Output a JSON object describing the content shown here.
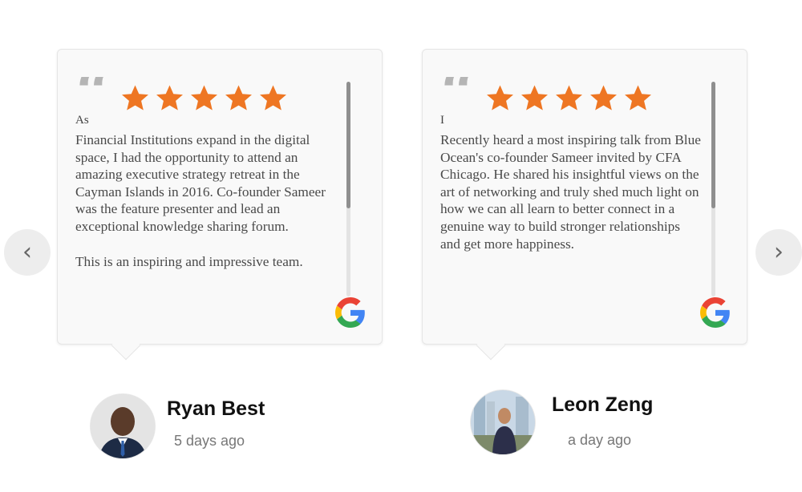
{
  "navigation": {
    "prev_icon": "‹",
    "next_icon": "›"
  },
  "reviews": [
    {
      "quote_mark": "“",
      "rating": 5,
      "lead_word": "As",
      "paragraphs": [
        "Financial Institutions expand in the digital space, I had the opportunity to attend an amazing executive strategy retreat in the Cayman Islands in 2016. Co-founder Sameer was the feature presenter and lead an exceptional knowledge sharing forum.",
        "This is an inspiring and impressive team."
      ],
      "source_icon": "google-icon",
      "reviewer": {
        "name": "Ryan Best",
        "time_ago": "5 days ago"
      }
    },
    {
      "quote_mark": "“",
      "rating": 5,
      "lead_word": "I",
      "paragraphs": [
        "Recently heard a most inspiring talk from Blue Ocean's co-founder Sameer invited by CFA Chicago.  He shared his insightful views on the art of networking and truly shed much light on how we can all learn to better connect in a genuine way to build stronger relationships and get more happiness."
      ],
      "source_icon": "google-icon",
      "reviewer": {
        "name": "Leon Zeng",
        "time_ago": "a day ago"
      }
    }
  ],
  "colors": {
    "star": "#ee7623",
    "quote_mark": "#b5b5b5",
    "card_bg": "#f9f9f9"
  }
}
